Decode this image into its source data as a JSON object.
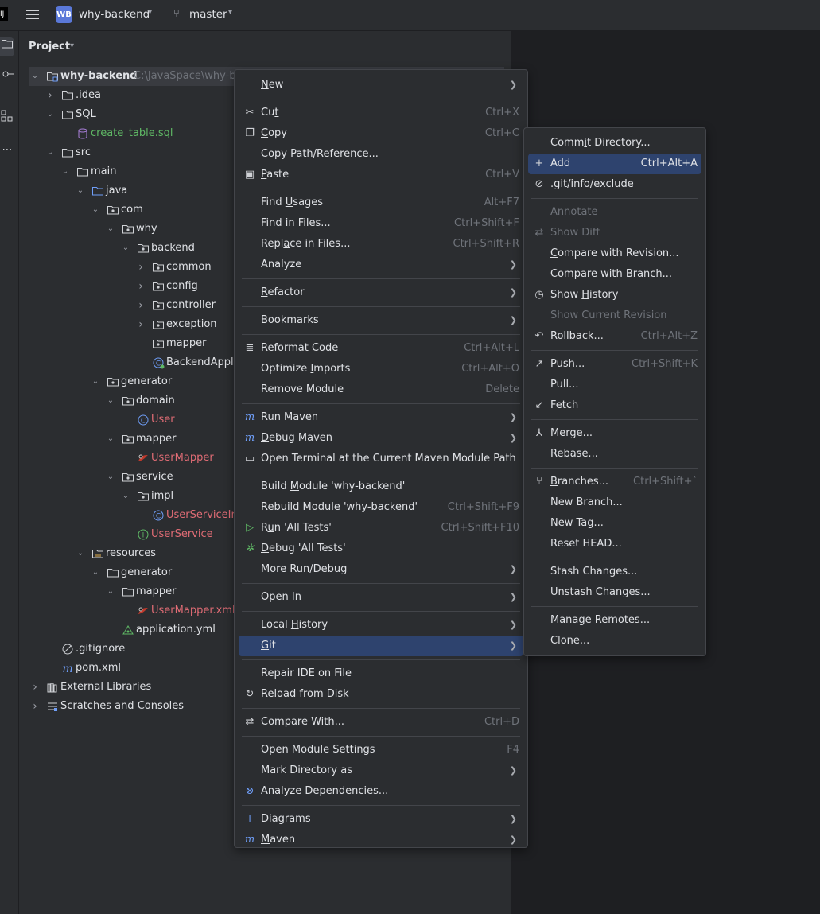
{
  "titlebar": {
    "app_icon": "intellij-icon",
    "project_badge": "WB",
    "project_name": "why-backend",
    "branch_name": "master"
  },
  "project_panel": {
    "title": "Project",
    "root_path": "C:\\JavaSpace\\why-b",
    "tree": [
      {
        "label": "why-backend",
        "icon": "module-folder"
      },
      {
        "label": ".idea",
        "icon": "folder"
      },
      {
        "label": "SQL",
        "icon": "folder"
      },
      {
        "label": "create_table.sql",
        "icon": "sql-file"
      },
      {
        "label": "src",
        "icon": "folder"
      },
      {
        "label": "main",
        "icon": "folder"
      },
      {
        "label": "java",
        "icon": "source-folder"
      },
      {
        "label": "com",
        "icon": "package"
      },
      {
        "label": "why",
        "icon": "package"
      },
      {
        "label": "backend",
        "icon": "package"
      },
      {
        "label": "common",
        "icon": "package"
      },
      {
        "label": "config",
        "icon": "package"
      },
      {
        "label": "controller",
        "icon": "package"
      },
      {
        "label": "exception",
        "icon": "package"
      },
      {
        "label": "mapper",
        "icon": "package"
      },
      {
        "label": "BackendAppli",
        "icon": "spring-class"
      },
      {
        "label": "generator",
        "icon": "package"
      },
      {
        "label": "domain",
        "icon": "package"
      },
      {
        "label": "User",
        "icon": "class"
      },
      {
        "label": "mapper",
        "icon": "package"
      },
      {
        "label": "UserMapper",
        "icon": "mybatis"
      },
      {
        "label": "service",
        "icon": "package"
      },
      {
        "label": "impl",
        "icon": "package"
      },
      {
        "label": "UserServiceIn",
        "icon": "class"
      },
      {
        "label": "UserService",
        "icon": "interface"
      },
      {
        "label": "resources",
        "icon": "resources-folder"
      },
      {
        "label": "generator",
        "icon": "folder"
      },
      {
        "label": "mapper",
        "icon": "folder"
      },
      {
        "label": "UserMapper.xml",
        "icon": "mybatis"
      },
      {
        "label": "application.yml",
        "icon": "yml"
      },
      {
        "label": ".gitignore",
        "icon": "ignore"
      },
      {
        "label": "pom.xml",
        "icon": "maven"
      },
      {
        "label": "External Libraries",
        "icon": "library"
      },
      {
        "label": "Scratches and Consoles",
        "icon": "scratches"
      }
    ]
  },
  "context_menu": {
    "items": [
      {
        "label": "New",
        "shortcut": "",
        "submenu": true
      },
      {
        "label": "Cut",
        "shortcut": "Ctrl+X",
        "icon": "scissors-icon"
      },
      {
        "label": "Copy",
        "shortcut": "Ctrl+C",
        "icon": "copy-icon"
      },
      {
        "label": "Copy Path/Reference...",
        "shortcut": ""
      },
      {
        "label": "Paste",
        "shortcut": "Ctrl+V",
        "icon": "paste-icon"
      },
      {
        "label": "Find Usages",
        "shortcut": "Alt+F7"
      },
      {
        "label": "Find in Files...",
        "shortcut": "Ctrl+Shift+F"
      },
      {
        "label": "Replace in Files...",
        "shortcut": "Ctrl+Shift+R"
      },
      {
        "label": "Analyze",
        "shortcut": "",
        "submenu": true
      },
      {
        "label": "Refactor",
        "shortcut": "",
        "submenu": true
      },
      {
        "label": "Bookmarks",
        "shortcut": "",
        "submenu": true
      },
      {
        "label": "Reformat Code",
        "shortcut": "Ctrl+Alt+L",
        "icon": "reformat-icon"
      },
      {
        "label": "Optimize Imports",
        "shortcut": "Ctrl+Alt+O"
      },
      {
        "label": "Remove Module",
        "shortcut": "Delete"
      },
      {
        "label": "Run Maven",
        "shortcut": "",
        "submenu": true,
        "icon": "maven-run-icon"
      },
      {
        "label": "Debug Maven",
        "shortcut": "",
        "submenu": true,
        "icon": "maven-debug-icon"
      },
      {
        "label": "Open Terminal at the Current Maven Module Path",
        "shortcut": "",
        "icon": "terminal-icon"
      },
      {
        "label": "Build Module 'why-backend'",
        "shortcut": ""
      },
      {
        "label": "Rebuild Module 'why-backend'",
        "shortcut": "Ctrl+Shift+F9"
      },
      {
        "label": "Run 'All Tests'",
        "shortcut": "Ctrl+Shift+F10",
        "icon": "run-icon"
      },
      {
        "label": "Debug 'All Tests'",
        "shortcut": "",
        "icon": "debug-icon"
      },
      {
        "label": "More Run/Debug",
        "shortcut": "",
        "submenu": true
      },
      {
        "label": "Open In",
        "shortcut": "",
        "submenu": true
      },
      {
        "label": "Local History",
        "shortcut": "",
        "submenu": true
      },
      {
        "label": "Git",
        "shortcut": "",
        "submenu": true
      },
      {
        "label": "Repair IDE on File",
        "shortcut": ""
      },
      {
        "label": "Reload from Disk",
        "shortcut": "",
        "icon": "reload-icon"
      },
      {
        "label": "Compare With...",
        "shortcut": "Ctrl+D",
        "icon": "compare-icon"
      },
      {
        "label": "Open Module Settings",
        "shortcut": "F4"
      },
      {
        "label": "Mark Directory as",
        "shortcut": "",
        "submenu": true
      },
      {
        "label": "Analyze Dependencies...",
        "shortcut": "",
        "icon": "dependencies-icon"
      },
      {
        "label": "Diagrams",
        "shortcut": "",
        "submenu": true,
        "icon": "diagrams-icon"
      },
      {
        "label": "Maven",
        "shortcut": "",
        "submenu": true,
        "icon": "maven-icon"
      }
    ]
  },
  "git_menu": {
    "items": [
      {
        "label": "Commit Directory...",
        "shortcut": ""
      },
      {
        "label": "Add",
        "shortcut": "Ctrl+Alt+A",
        "icon": "plus-icon"
      },
      {
        "label": ".git/info/exclude",
        "shortcut": "",
        "icon": "ignore-icon"
      },
      {
        "label": "Annotate",
        "shortcut": "",
        "disabled": true
      },
      {
        "label": "Show Diff",
        "shortcut": "",
        "disabled": true,
        "icon": "diff-icon"
      },
      {
        "label": "Compare with Revision...",
        "shortcut": ""
      },
      {
        "label": "Compare with Branch...",
        "shortcut": ""
      },
      {
        "label": "Show History",
        "shortcut": "",
        "icon": "history-icon"
      },
      {
        "label": "Show Current Revision",
        "shortcut": "",
        "disabled": true
      },
      {
        "label": "Rollback...",
        "shortcut": "Ctrl+Alt+Z",
        "icon": "rollback-icon"
      },
      {
        "label": "Push...",
        "shortcut": "Ctrl+Shift+K",
        "icon": "push-icon"
      },
      {
        "label": "Pull...",
        "shortcut": ""
      },
      {
        "label": "Fetch",
        "shortcut": "",
        "icon": "fetch-icon"
      },
      {
        "label": "Merge...",
        "shortcut": "",
        "icon": "merge-icon"
      },
      {
        "label": "Rebase...",
        "shortcut": ""
      },
      {
        "label": "Branches...",
        "shortcut": "Ctrl+Shift+`",
        "icon": "branch-icon"
      },
      {
        "label": "New Branch...",
        "shortcut": ""
      },
      {
        "label": "New Tag...",
        "shortcut": ""
      },
      {
        "label": "Reset HEAD...",
        "shortcut": ""
      },
      {
        "label": "Stash Changes...",
        "shortcut": ""
      },
      {
        "label": "Unstash Changes...",
        "shortcut": ""
      },
      {
        "label": "Manage Remotes...",
        "shortcut": ""
      },
      {
        "label": "Clone...",
        "shortcut": ""
      }
    ]
  },
  "colors": {
    "background": "#1e1f22",
    "panel": "#2b2d30",
    "selection": "#2e436e",
    "modified_file": "#e06c75",
    "added_file": "#5fb865",
    "shortcut": "#6f737a"
  }
}
